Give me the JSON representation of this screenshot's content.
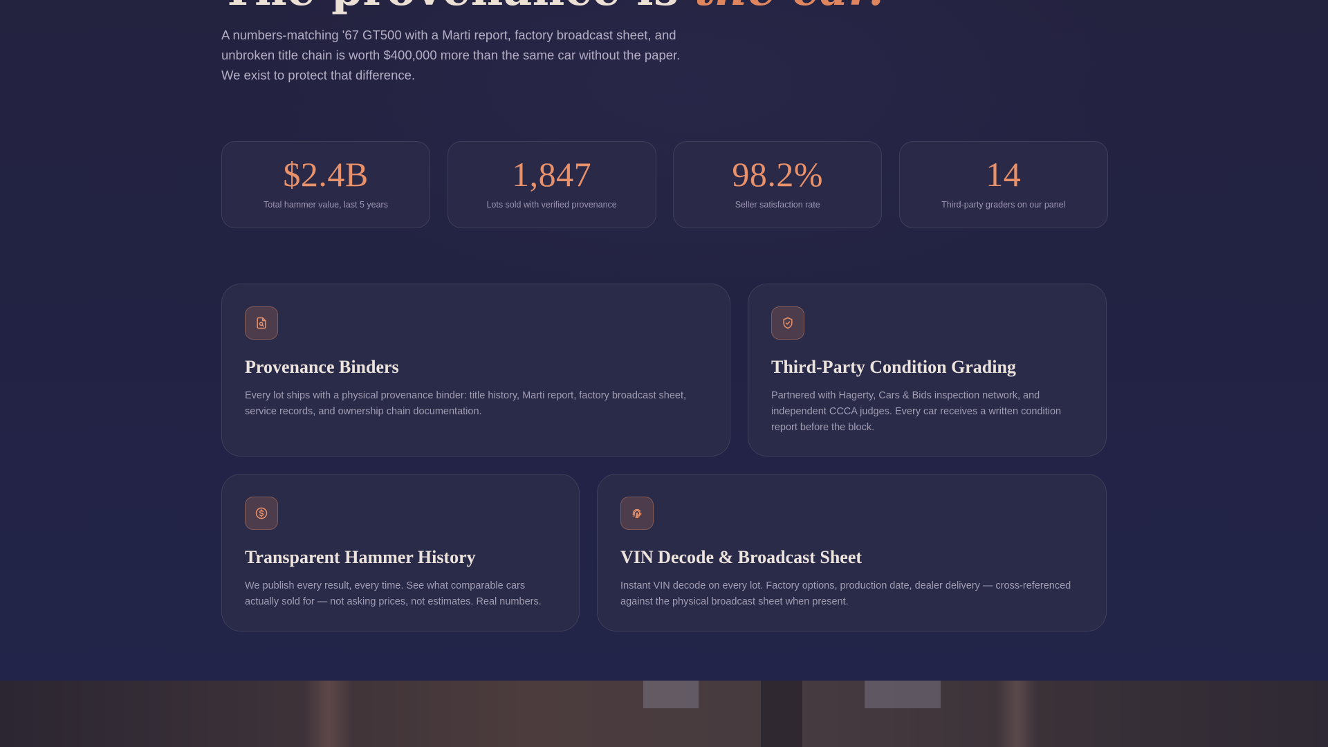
{
  "hero": {
    "title_main": "The provenance is ",
    "title_accent": "the car.",
    "intro": "A numbers-matching '67 GT500 with a Marti report, factory broadcast sheet, and unbroken title chain is worth $400,000 more than the same car without the paper. We exist to protect that difference."
  },
  "stats": [
    {
      "value": "$2.4B",
      "label": "Total hammer value, last 5 years"
    },
    {
      "value": "1,847",
      "label": "Lots sold with verified provenance"
    },
    {
      "value": "98.2%",
      "label": "Seller satisfaction rate"
    },
    {
      "value": "14",
      "label": "Third-party graders on our panel"
    }
  ],
  "features": [
    {
      "icon": "document-search-icon",
      "title": "Provenance Binders",
      "desc": "Every lot ships with a physical provenance binder: title history, Marti report, factory broadcast sheet, service records, and ownership chain documentation."
    },
    {
      "icon": "shield-check-icon",
      "title": "Third-Party Condition Grading",
      "desc": "Partnered with Hagerty, Cars & Bids inspection network, and independent CCCA judges. Every car receives a written condition report before the block."
    },
    {
      "icon": "dollar-circle-icon",
      "title": "Transparent Hammer History",
      "desc": "We publish every result, every time. See what comparable cars actually sold for — not asking prices, not estimates. Real numbers."
    },
    {
      "icon": "fingerprint-icon",
      "title": "VIN Decode & Broadcast Sheet",
      "desc": "Instant VIN decode on every lot. Factory options, production date, dealer delivery — cross-referenced against the physical broadcast sheet when present."
    }
  ],
  "colors": {
    "accent": "#e8916a",
    "background": "#22223f",
    "card": "#2a2a49"
  }
}
